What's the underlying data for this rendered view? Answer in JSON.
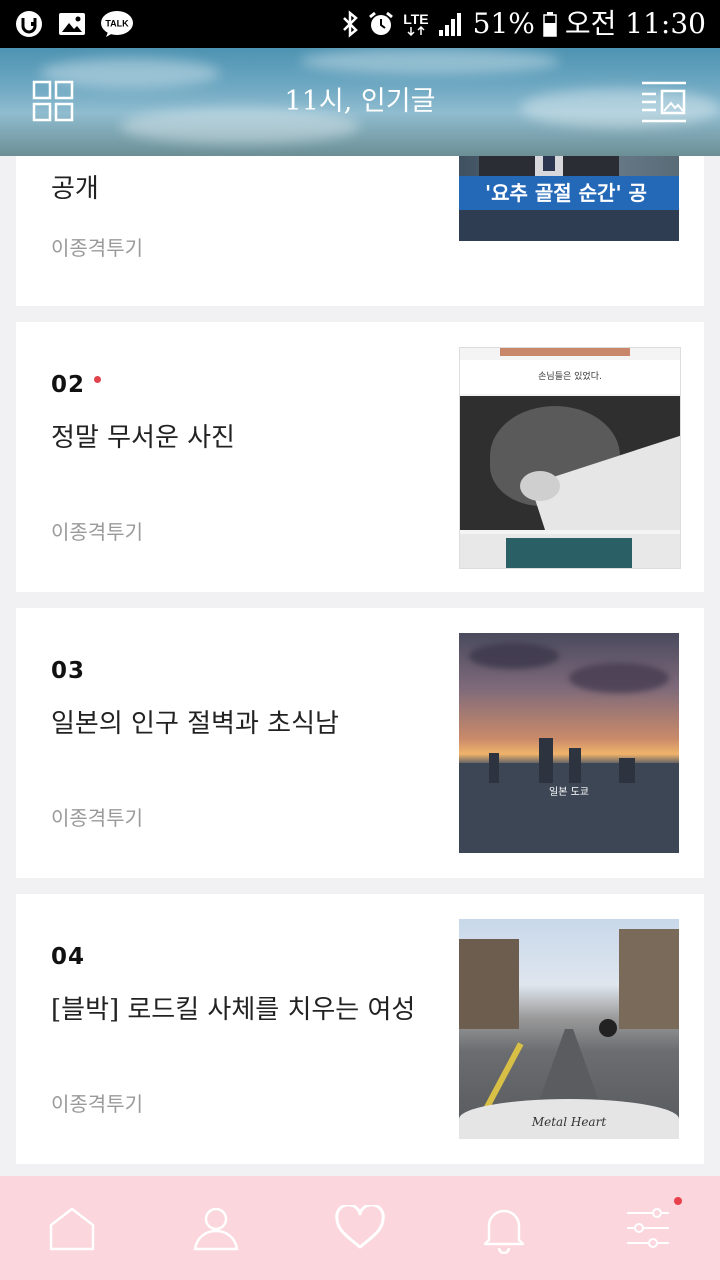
{
  "status_bar": {
    "battery": "51%",
    "time": "오전 11:30",
    "network": "LTE",
    "icons": [
      "u-plus-icon",
      "gallery-icon",
      "kakaotalk-icon",
      "bluetooth-icon",
      "alarm-icon",
      "lte-icon",
      "signal-icon",
      "battery-icon"
    ],
    "talk_label": "TALK"
  },
  "header": {
    "title": "11시, 인기글",
    "left_icon": "grid-icon",
    "right_icon": "list-view-icon"
  },
  "posts": [
    {
      "rank": "",
      "title": "공개",
      "author": "이종격투기",
      "thumb_caption": "'요추 골절 순간' 공",
      "is_new": false
    },
    {
      "rank": "02",
      "title": "정말 무서운 사진",
      "author": "이종격투기",
      "thumb_caption": "손님들은 있었다.",
      "is_new": true
    },
    {
      "rank": "03",
      "title": "일본의 인구 절벽과 초식남",
      "author": "이종격투기",
      "thumb_caption": "일본 도쿄",
      "is_new": false
    },
    {
      "rank": "04",
      "title": "[블박] 로드킬 사체를 치우는 여성",
      "author": "이종격투기",
      "thumb_caption": "Metal Heart",
      "is_new": false
    }
  ],
  "bottom_nav": {
    "items": [
      "home-icon",
      "profile-icon",
      "heart-icon",
      "bell-icon",
      "settings-sliders-icon"
    ],
    "active": "heart-icon",
    "notification_on": "settings-sliders-icon"
  },
  "colors": {
    "nav_bg": "#fbd6dd",
    "accent_dot": "#e0434b",
    "header_sky": "#6ea8c2"
  }
}
